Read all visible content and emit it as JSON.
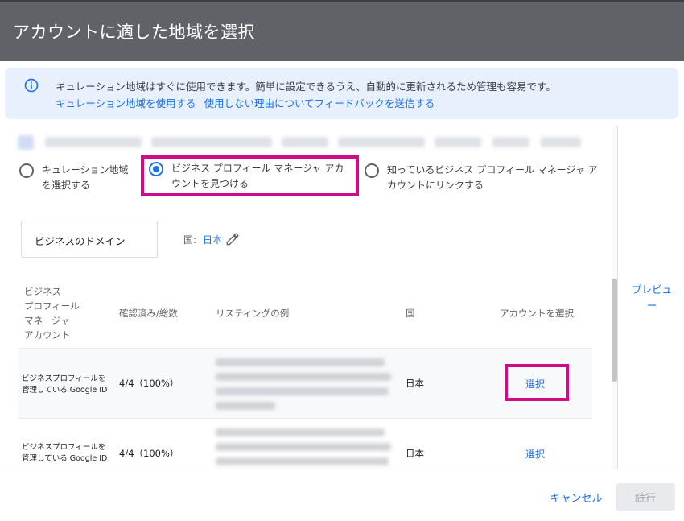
{
  "dialog": {
    "title": "アカウントに適した地域を選択"
  },
  "banner": {
    "icon": "info-icon",
    "text": "キュレーション地域はすぐに使用できます。簡単に設定できるうえ、自動的に更新されるため管理も容易です。",
    "link_use": "キュレーション地域を使用する",
    "link_feedback": "使用しない理由についてフィードバックを送信する",
    "accent_color": "#1a73e8"
  },
  "radio_options": [
    {
      "label_line1": "キュレーション地域",
      "label_line2": "を選択する",
      "selected": false
    },
    {
      "label_line1": "ビジネス プロフィール マネージャ アカ",
      "label_line2": "ウントを見つける",
      "selected": true
    },
    {
      "label_line1": "知っているビジネス プロフィール マネージャ ア",
      "label_line2": "カウントにリンクする",
      "selected": false
    }
  ],
  "domain_field": {
    "label": "ビジネスのドメイン"
  },
  "country": {
    "label": "国:",
    "value": "日本",
    "edit_icon": "pencil-icon"
  },
  "table": {
    "headers": {
      "account_line1": "ビジネス",
      "account_line2": "プロフィール",
      "account_line3": "マネージャ",
      "account_line4": "アカウント",
      "verified": "確認済み/総数",
      "listing": "リスティングの例",
      "country": "国",
      "select": "アカウントを選択"
    },
    "rows": [
      {
        "id_line1": "ビジネスプロフィールを",
        "id_line2": "管理している Google ID",
        "verified": "4/4（100%）",
        "country": "日本",
        "select": "選択"
      },
      {
        "id_line1": "ビジネスプロフィールを",
        "id_line2": "管理している Google ID",
        "verified": "4/4（100%）",
        "country": "日本",
        "select": "選択"
      }
    ]
  },
  "side": {
    "preview_line1": "プレビュ",
    "preview_line2": "ー"
  },
  "footer": {
    "cancel": "キャンセル",
    "continue": "続行"
  },
  "colors": {
    "title_bar": "#5f6368",
    "link": "#1a73e8",
    "highlight": "#d10a8a",
    "banner_bg": "#e8f0fe"
  }
}
